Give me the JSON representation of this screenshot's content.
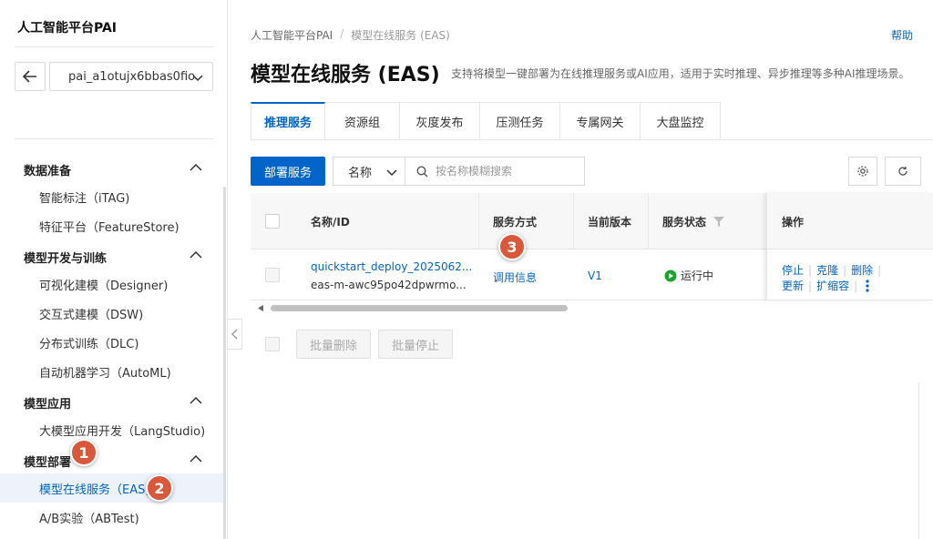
{
  "sidebar": {
    "brand": "人工智能平台PAI",
    "workspace": "pai_a1otujx6bbas0fio",
    "groups": [
      {
        "label": "数据准备",
        "items": [
          "智能标注（iTAG)",
          "特征平台（FeatureStore)"
        ]
      },
      {
        "label": "模型开发与训练",
        "items": [
          "可视化建模（Designer)",
          "交互式建模（DSW)",
          "分布式训练（DLC)",
          "自动机器学习（AutoML)"
        ]
      },
      {
        "label": "模型应用",
        "items": [
          "大模型应用开发（LangStudio)"
        ]
      },
      {
        "label": "模型部署",
        "items": [
          "模型在线服务（EAS)",
          "A/B实验（ABTest)"
        ]
      }
    ]
  },
  "badges": [
    "1",
    "2",
    "3"
  ],
  "breadcrumb": {
    "root": "人工智能平台PAI",
    "sep": "/",
    "current": "模型在线服务 (EAS)"
  },
  "help": "帮助",
  "page": {
    "title": "模型在线服务 (EAS)",
    "description": "支持将模型一键部署为在线推理服务或AI应用，适用于实时推理、异步推理等多种AI推理场景。"
  },
  "tabs": [
    "推理服务",
    "资源组",
    "灰度发布",
    "压测任务",
    "专属网关",
    "大盘监控"
  ],
  "toolbar": {
    "deploy": "部署服务",
    "filter": "名称",
    "search_placeholder": "按名称模糊搜索"
  },
  "table": {
    "headers": {
      "name": "名称/ID",
      "method": "服务方式",
      "version": "当前版本",
      "status": "服务状态",
      "ops": "操作"
    },
    "rows": [
      {
        "name": "quickstart_deploy_2025062...",
        "id": "eas-m-awc95po42dpwrmo...",
        "method": "调用信息",
        "version": "V1",
        "status": "运行中",
        "ops1": [
          "停止",
          "克隆",
          "删除"
        ],
        "ops2": [
          "更新",
          "扩缩容"
        ]
      }
    ]
  },
  "batch": {
    "delete": "批量删除",
    "stop": "批量停止"
  },
  "colors": {
    "accent": "#0064c8",
    "badge": "#d9573b",
    "running": "#1aa530",
    "brand_stripe": "#ff6a00"
  }
}
